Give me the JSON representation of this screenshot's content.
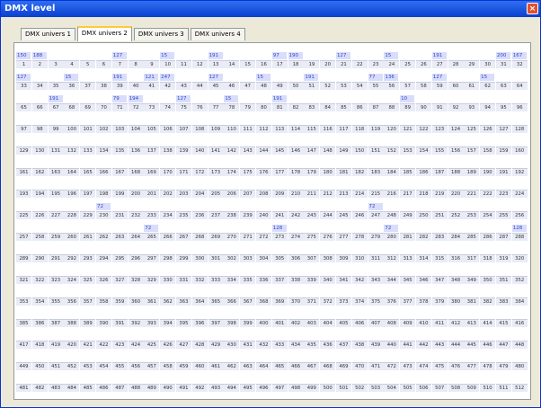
{
  "window": {
    "title": "DMX level",
    "close_glyph": "×"
  },
  "tabs": [
    {
      "label": "DMX univers 1",
      "active": false
    },
    {
      "label": "DMX univers 2",
      "active": true
    },
    {
      "label": "DMX univers 3",
      "active": false
    },
    {
      "label": "DMX univers 4",
      "active": false
    }
  ],
  "grid": {
    "first_channel": 1,
    "channel_count": 512,
    "levels": {
      "1": 150,
      "2": 188,
      "7": 127,
      "10": 15,
      "13": 191,
      "17": 97,
      "18": 190,
      "21": 127,
      "24": 15,
      "27": 191,
      "31": 200,
      "32": 167,
      "33": 127,
      "36": 15,
      "39": 191,
      "41": 121,
      "42": 247,
      "45": 127,
      "48": 15,
      "51": 191,
      "55": 77,
      "56": 136,
      "59": 127,
      "62": 15,
      "67": 191,
      "71": 79,
      "72": 194,
      "75": 127,
      "78": 15,
      "81": 191,
      "89": 10,
      "230": 72,
      "247": 72,
      "265": 72,
      "273": 128,
      "280": 72,
      "288": 128
    }
  }
}
